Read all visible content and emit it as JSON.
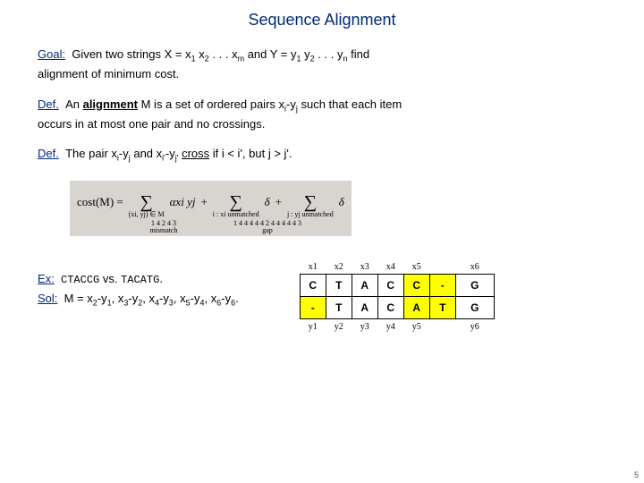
{
  "title": "Sequence Alignment",
  "goal": {
    "label": "Goal:",
    "text_before": "Given two strings X = x",
    "seq1_frag1": " x",
    "seq1_dots": " . . . x",
    "mid": " and Y = y",
    "seq2_frag1": " y",
    "seq2_dots": " . . . y",
    "tail": " find",
    "line2": "alignment of minimum cost."
  },
  "def1": {
    "label": "Def.",
    "p1": "An ",
    "strong": "alignment",
    "p2": " M is a set of ordered pairs x",
    "p3": "-y",
    "p4": " such that each item",
    "line2": "occurs in at most one pair and no crossings."
  },
  "def2": {
    "label": "Def.",
    "p1": "The pair x",
    "p2": "-y",
    "p3": " and x",
    "p4": "-y",
    "p5": " ",
    "cross": "cross",
    "p6": " if i < i', but j > j'."
  },
  "formula": {
    "lhs": "cost(M)  =",
    "sum1_bot": "(xi, yj) ∈ M",
    "term1": "αxi yj",
    "plus1": "+",
    "sum2_bot": "i : xi unmatched",
    "term2": "δ",
    "plus2": "+",
    "sum3_bot": "j : yj unmatched",
    "term3": "δ",
    "brace1": "mismatch",
    "brace2": "gap",
    "b1": "1 4 2 4 3",
    "b2": "1 4 4 4 4 4 2 4 4 4 4 4 3"
  },
  "ex": {
    "label": "Ex:",
    "s1": "CTACCG",
    "vs": " vs. ",
    "s2": "TACATG",
    "dot": "."
  },
  "sol": {
    "label": "Sol:",
    "text": "M = x",
    "pairs": [
      [
        "2",
        "1"
      ],
      [
        "3",
        "2"
      ],
      [
        "4",
        "3"
      ],
      [
        "5",
        "4"
      ],
      [
        "6",
        "6"
      ]
    ],
    "sep": "-y",
    "comma": ", x",
    "end": "."
  },
  "table": {
    "xhdr": [
      "x1",
      "x2",
      "x3",
      "x4",
      "x5",
      "",
      "x6"
    ],
    "row1": [
      "C",
      "T",
      "A",
      "C",
      "C",
      "-",
      "G"
    ],
    "row2": [
      "-",
      "T",
      "A",
      "C",
      "A",
      "T",
      "G"
    ],
    "yhdr": [
      "y1",
      "y2",
      "y3",
      "y4",
      "y5",
      "",
      "y6"
    ]
  },
  "pagenum": "5"
}
